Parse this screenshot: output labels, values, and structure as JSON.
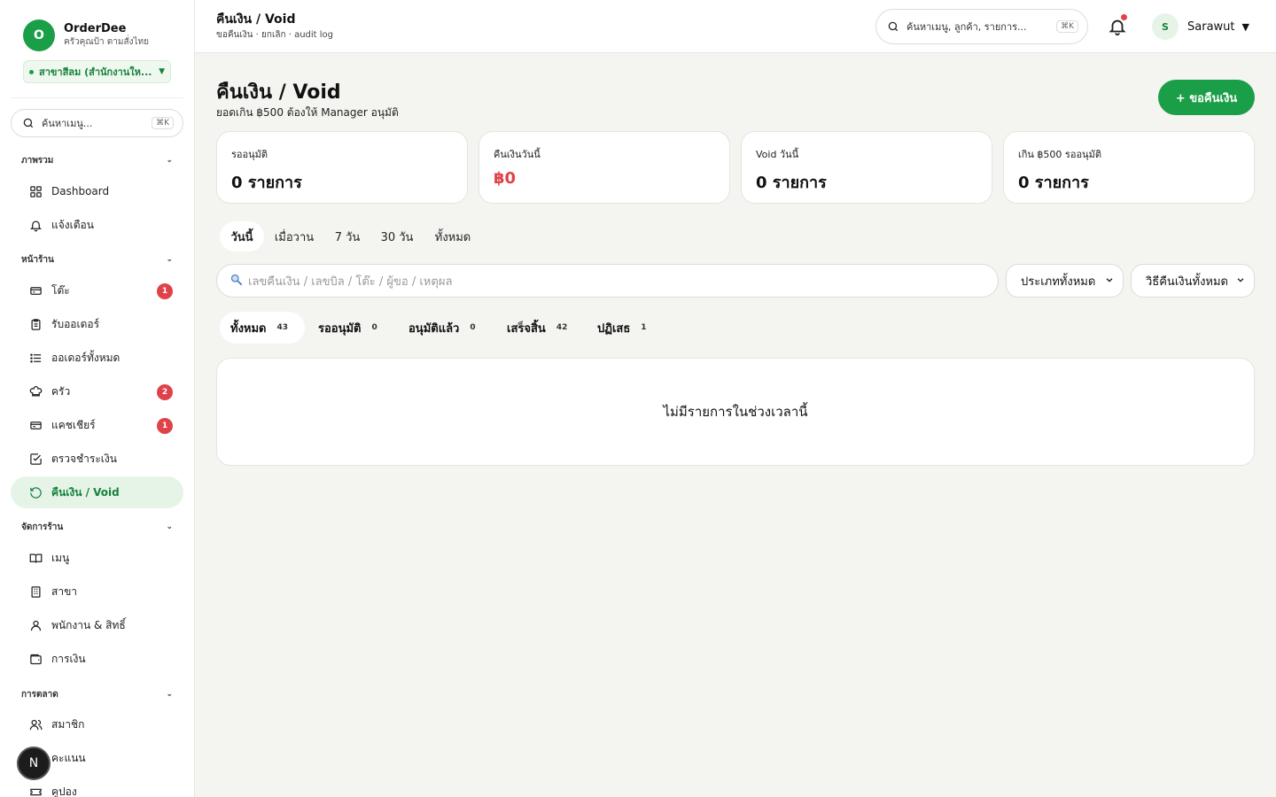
{
  "brand": {
    "logo_letter": "O",
    "name": "OrderDee",
    "subtitle": "ครัวคุณป้า ตามสั่งไทย"
  },
  "branch": {
    "label": "สาขาสีลม (สำนักงานให...",
    "status_color": "#1a9e48"
  },
  "sidebar": {
    "search_placeholder": "ค้นหาเมนู...",
    "search_shortcut": "⌘K",
    "sections": [
      {
        "title": "ภาพรวม",
        "items": [
          {
            "label": "Dashboard",
            "icon": "grid-icon"
          },
          {
            "label": "แจ้งเตือน",
            "icon": "bell-icon"
          }
        ]
      },
      {
        "title": "หน้าร้าน",
        "items": [
          {
            "label": "โต๊ะ",
            "icon": "table-icon",
            "badge": "1"
          },
          {
            "label": "รับออเดอร์",
            "icon": "clipboard-icon"
          },
          {
            "label": "ออเดอร์ทั้งหมด",
            "icon": "list-icon"
          },
          {
            "label": "ครัว",
            "icon": "chef-hat-icon",
            "badge": "2"
          },
          {
            "label": "แคชเชียร์",
            "icon": "card-icon",
            "badge": "1"
          },
          {
            "label": "ตรวจชำระเงิน",
            "icon": "check-square-icon"
          },
          {
            "label": "คืนเงิน / Void",
            "icon": "refund-icon",
            "active": true
          }
        ]
      },
      {
        "title": "จัดการร้าน",
        "items": [
          {
            "label": "เมนู",
            "icon": "book-icon"
          },
          {
            "label": "สาขา",
            "icon": "building-icon"
          },
          {
            "label": "พนักงาน & สิทธิ์",
            "icon": "user-icon"
          },
          {
            "label": "การเงิน",
            "icon": "wallet-icon"
          }
        ]
      },
      {
        "title": "การตลาด",
        "items": [
          {
            "label": "สมาชิก",
            "icon": "users-icon"
          },
          {
            "label": "คะแนน",
            "icon": "star-icon"
          },
          {
            "label": "คูปอง",
            "icon": "ticket-icon"
          }
        ]
      }
    ]
  },
  "devtools_badge": "N",
  "topbar": {
    "title": "คืนเงิน / Void",
    "subtitle": "ขอคืนเงิน · ยกเลิก · audit log",
    "search_placeholder": "ค้นหาเมนู, ลูกค้า, รายการ...",
    "search_shortcut": "⌘K",
    "user_initial": "S",
    "user_name": "Sarawut"
  },
  "page": {
    "title": "คืนเงิน / Void",
    "subtitle": "ยอดเกิน ฿500 ต้องให้ Manager อนุมัติ",
    "add_button": "+ ขอคืนเงิน"
  },
  "stats": [
    {
      "label": "รออนุมัติ",
      "value": "0 รายการ"
    },
    {
      "label": "คืนเงินวันนี้",
      "value": "฿0",
      "highlight": "#e0424a"
    },
    {
      "label": "Void วันนี้",
      "value": "0 รายการ"
    },
    {
      "label": "เกิน ฿500 รออนุมัติ",
      "value": "0 รายการ"
    }
  ],
  "range_tabs": [
    {
      "label": "วันนี้",
      "active": true
    },
    {
      "label": "เมื่อวาน"
    },
    {
      "label": "7 วัน"
    },
    {
      "label": "30 วัน"
    },
    {
      "label": "ทั้งหมด"
    }
  ],
  "filters": {
    "search_placeholder": "เลขคืนเงิน / เลขบิล / โต๊ะ / ผู้ขอ / เหตุผล",
    "type_select": "ประเภททั้งหมด",
    "method_select": "วิธีคืนเงินทั้งหมด"
  },
  "status_tabs": [
    {
      "label": "ทั้งหมด",
      "count": "43",
      "active": true
    },
    {
      "label": "รออนุมัติ",
      "count": "0"
    },
    {
      "label": "อนุมัติแล้ว",
      "count": "0"
    },
    {
      "label": "เสร็จสิ้น",
      "count": "42"
    },
    {
      "label": "ปฏิเสธ",
      "count": "1"
    }
  ],
  "empty_message": "ไม่มีรายการในช่วงเวลานี้",
  "colors": {
    "brand_green": "#1a9e48",
    "badge_red": "#e0424a",
    "background": "#f4f4f1"
  }
}
